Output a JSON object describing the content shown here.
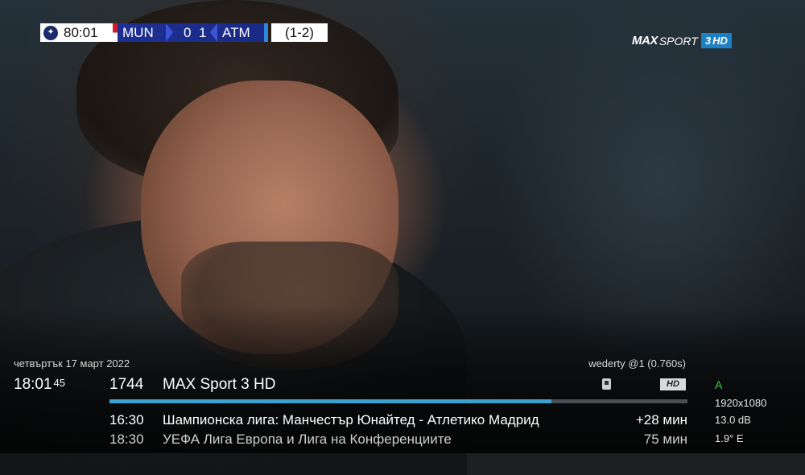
{
  "scoreboard": {
    "match_time": "80:01",
    "home_team": "MUN",
    "home_score": "0",
    "away_score": "1",
    "away_team": "ATM",
    "aggregate": "(1-2)"
  },
  "channel_logo": {
    "brand": "MAX",
    "sport": "SPORT",
    "number": "3",
    "hd": "HD"
  },
  "infobar": {
    "date": "четвъртък 17 март 2022",
    "clock_hm": "18:01",
    "clock_sec": "45",
    "signal_info": "wederty @1 (0.760s)",
    "channel_number": "1744",
    "channel_name": "MAX Sport 3 HD",
    "hd_badge": "HD",
    "progress_fraction": 0.765,
    "now": {
      "time": "16:30",
      "title": "Шампионска лига: Манчестър Юнайтед - Атлетико Мадрид",
      "duration": "+28 мин"
    },
    "next": {
      "time": "18:30",
      "title": "УЕФА Лига Европа и Лига на Конференциите",
      "duration": "75 мин"
    },
    "tech": {
      "audio": "A",
      "resolution": "1920x1080",
      "snr": "13.0 dB",
      "satellite": "1.9° E"
    }
  },
  "icons": {
    "lock": "lock-icon",
    "ball": "champions-league-ball-icon"
  },
  "colors": {
    "progress": "#3ca1cf",
    "score_blue": "#1e2f92",
    "logo_blue": "#1d7fc4",
    "audio_green": "#3ccf4a"
  }
}
